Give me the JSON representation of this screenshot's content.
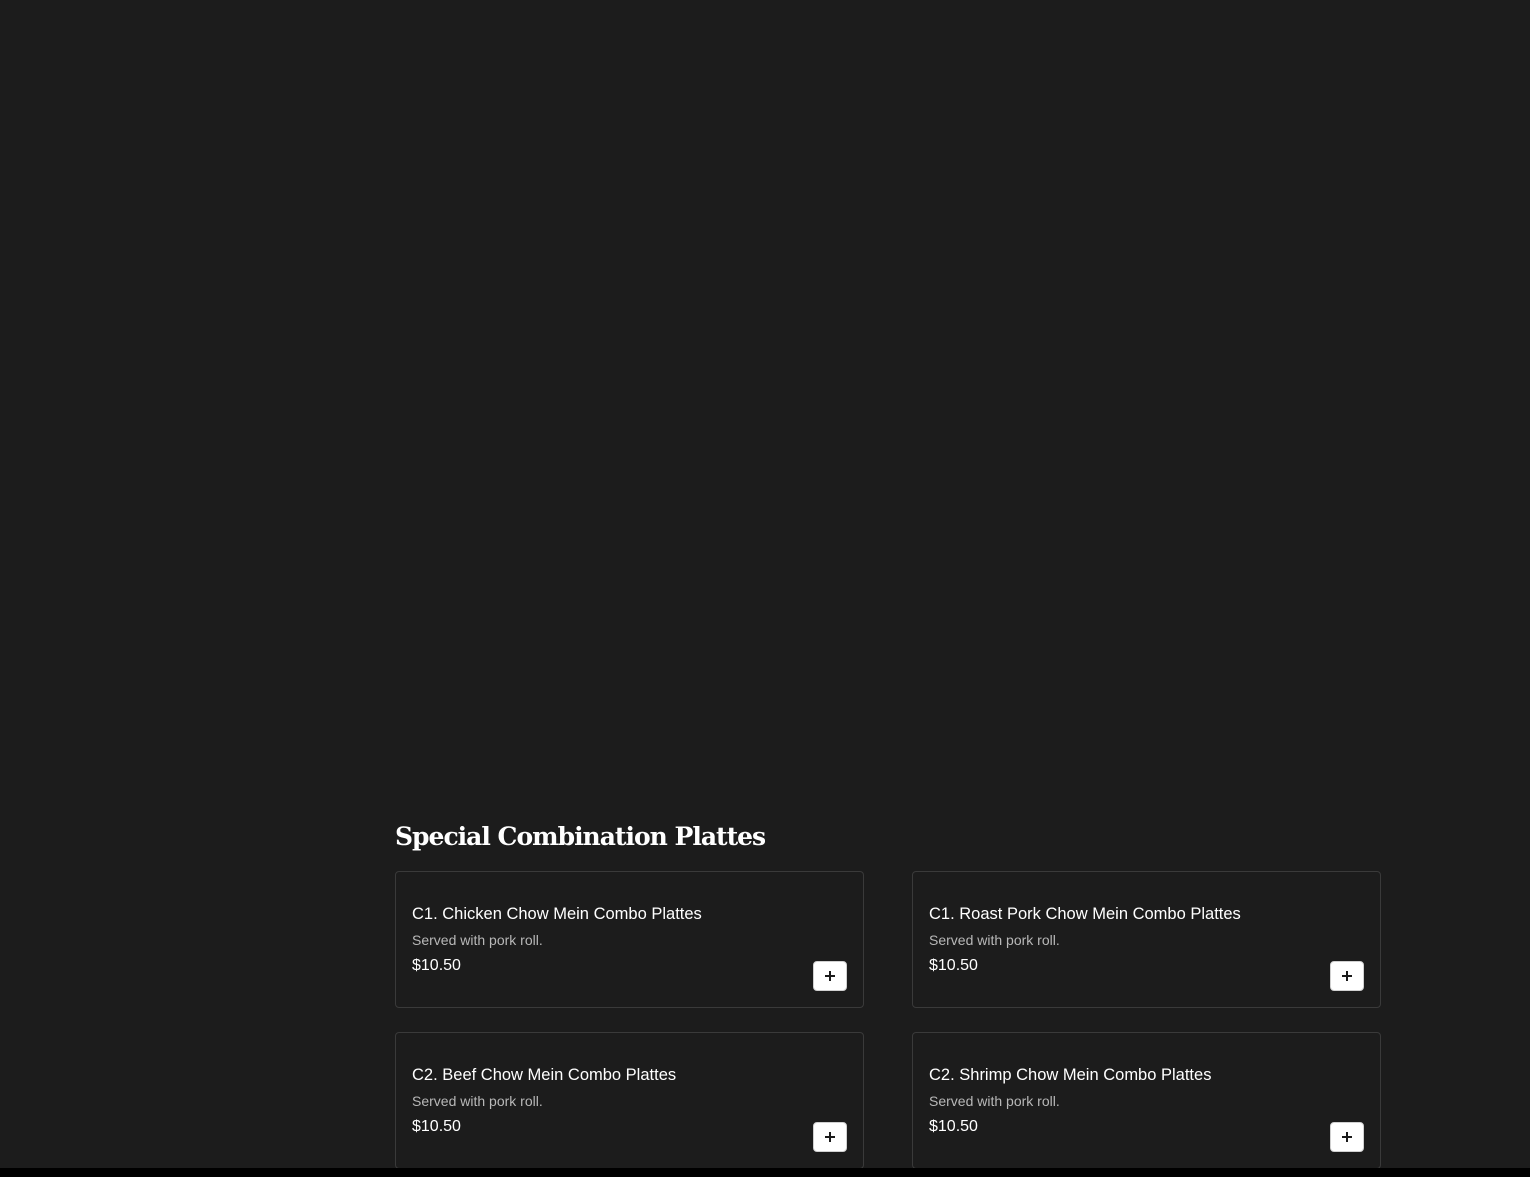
{
  "section": {
    "title": "Special Combination Plattes",
    "items": [
      {
        "name": "C1. Chicken Chow Mein Combo Plattes",
        "description": "Served with pork roll.",
        "price": "$10.50",
        "add_icon": "plus-icon"
      },
      {
        "name": "C1. Roast Pork Chow Mein Combo Plattes",
        "description": "Served with pork roll.",
        "price": "$10.50",
        "add_icon": "plus-icon"
      },
      {
        "name": "C2. Beef Chow Mein Combo Plattes",
        "description": "Served with pork roll.",
        "price": "$10.50",
        "add_icon": "plus-icon"
      },
      {
        "name": "C2. Shrimp Chow Mein Combo Plattes",
        "description": "Served with pork roll.",
        "price": "$10.50",
        "add_icon": "plus-icon"
      }
    ]
  },
  "colors": {
    "background": "#1c1c1c",
    "card_border": "#3a3a3a",
    "text": "#ffffff",
    "muted_text": "#b8b8b8",
    "button_bg": "#ffffff"
  }
}
